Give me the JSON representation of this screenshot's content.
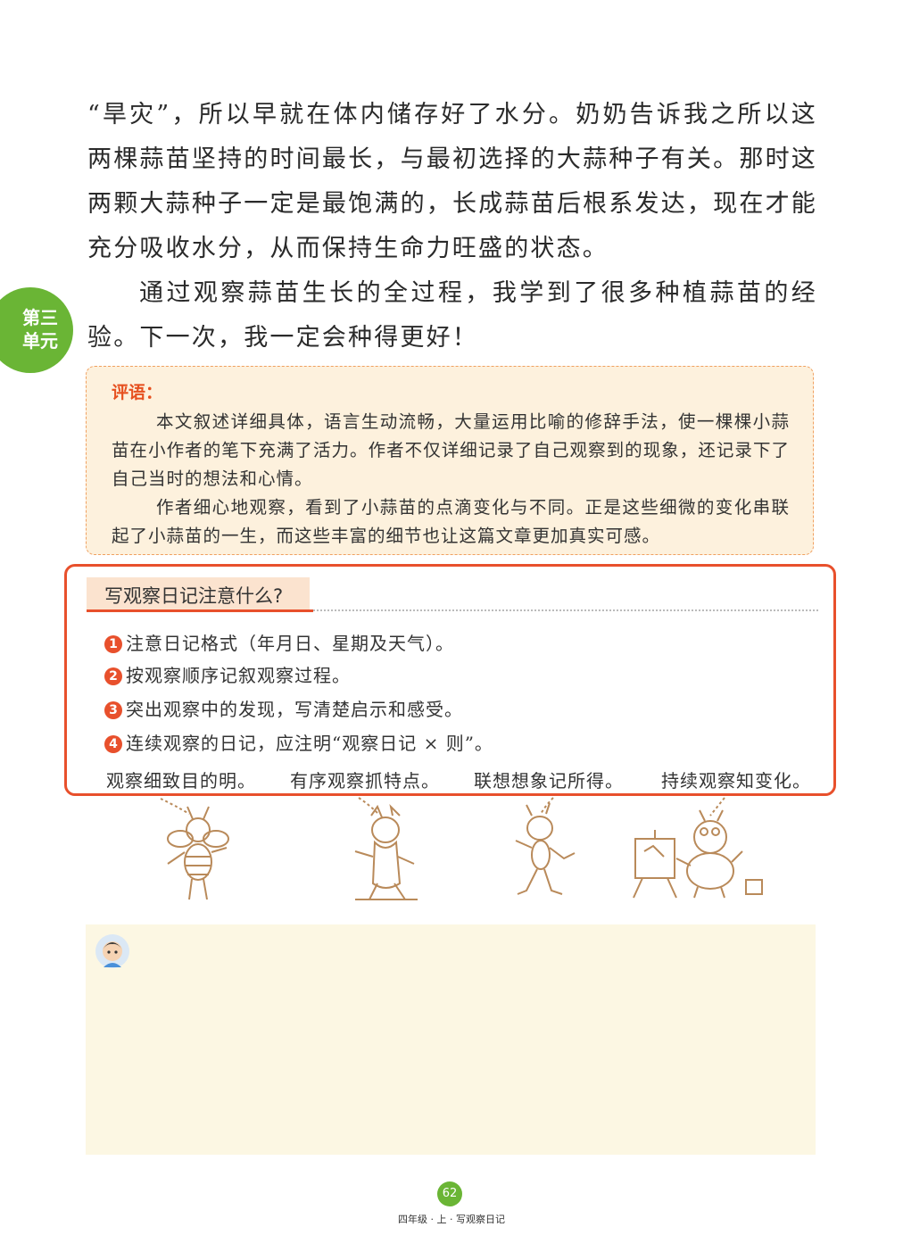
{
  "body": {
    "paragraph1": "“旱灾”，所以早就在体内储存好了水分。奶奶告诉我之所以这两棵蒜苗坚持的时间最长，与最初选择的大蒜种子有关。那时这两颗大蒜种子一定是最饱满的，长成蒜苗后根系发达，现在才能充分吸收水分，从而保持生命力旺盛的状态。",
    "paragraph2": "通过观察蒜苗生长的全过程，我学到了很多种植蒜苗的经验。下一次，我一定会种得更好！"
  },
  "unit_badge": "第三单元",
  "comment": {
    "title": "评语：",
    "p1": "本文叙述详细具体，语言生动流畅，大量运用比喻的修辞手法，使一棵棵小蒜苗在小作者的笔下充满了活力。作者不仅详细记录了自己观察到的现象，还记录下了自己当时的想法和心情。",
    "p2": "作者细心地观察，看到了小蒜苗的点滴变化与不同。正是这些细微的变化串联起了小蒜苗的一生，而这些丰富的细节也让这篇文章更加真实可感。"
  },
  "tips": {
    "title": "写观察日记注意什么?",
    "items": [
      {
        "num": "1",
        "text": "注意日记格式（年月日、星期及天气）。"
      },
      {
        "num": "2",
        "text": "按观察顺序记叙观察过程。"
      },
      {
        "num": "3",
        "text": "突出观察中的发现，写清楚启示和感受。"
      },
      {
        "num": "4",
        "text": "连续观察的日记，应注明“观察日记 × 则”。"
      }
    ],
    "slogans": [
      "观察细致目的明。",
      "有序观察抓特点。",
      "联想想象记所得。",
      "持续观察知变化。"
    ]
  },
  "illustrations": [
    "bee",
    "cricket",
    "ant",
    "caterpillar-painter"
  ],
  "footer": {
    "page_number": "62",
    "caption": "四年级 · 上 · 写观察日记"
  },
  "colors": {
    "accent_red": "#e8502c",
    "green": "#6ab535",
    "comment_bg": "#fdf1dd",
    "write_bg": "#fcf7e3",
    "sketch": "#b98a5a"
  }
}
